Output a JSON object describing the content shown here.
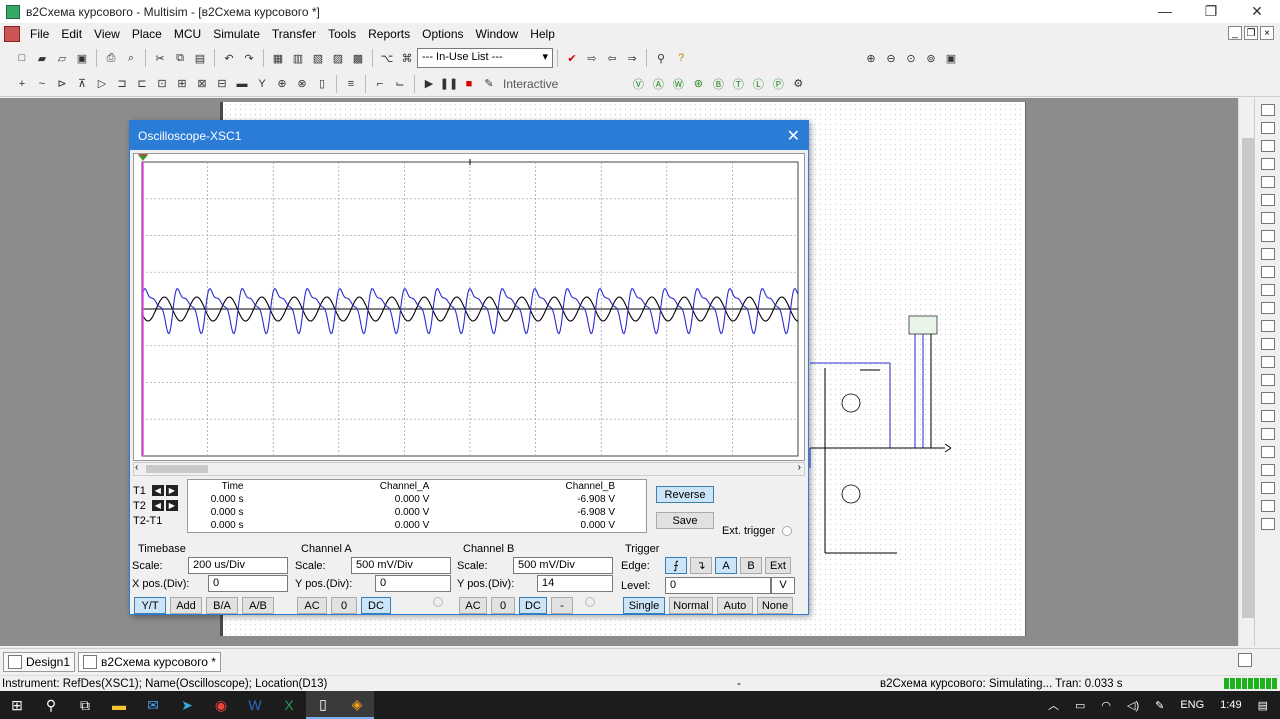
{
  "window": {
    "title": "в2Схема курсового - Multisim - [в2Схема курсового *]",
    "controls": [
      "—",
      "❐",
      "✕"
    ]
  },
  "menu": {
    "items": [
      "File",
      "Edit",
      "View",
      "Place",
      "MCU",
      "Simulate",
      "Transfer",
      "Tools",
      "Reports",
      "Options",
      "Window",
      "Help"
    ]
  },
  "toolbar": {
    "in_use_list": "--- In-Use List ---",
    "interactive_label": "Interactive"
  },
  "oscilloscope": {
    "title": "Oscilloscope-XSC1",
    "close": "✕",
    "readout": {
      "row_labels": [
        "T1",
        "T2",
        "T2-T1"
      ],
      "headers": [
        "Time",
        "Channel_A",
        "Channel_B"
      ],
      "rows": [
        [
          "0.000 s",
          "0.000 V",
          "-6.908 V"
        ],
        [
          "0.000 s",
          "0.000 V",
          "-6.908 V"
        ],
        [
          "0.000 s",
          "0.000 V",
          "0.000 V"
        ]
      ]
    },
    "reverse_label": "Reverse",
    "save_label": "Save",
    "ext_trigger_label": "Ext. trigger",
    "timebase": {
      "title": "Timebase",
      "scale_label": "Scale:",
      "scale": "200 us/Div",
      "xpos_label": "X pos.(Div):",
      "xpos": "0",
      "buttons": [
        "Y/T",
        "Add",
        "B/A",
        "A/B"
      ]
    },
    "channel_a": {
      "title": "Channel A",
      "scale_label": "Scale:",
      "scale": "500 mV/Div",
      "ypos_label": "Y pos.(Div):",
      "ypos": "0",
      "buttons": [
        "AC",
        "0",
        "DC"
      ]
    },
    "channel_b": {
      "title": "Channel B",
      "scale_label": "Scale:",
      "scale": "500 mV/Div",
      "ypos_label": "Y pos.(Div):",
      "ypos": "14",
      "buttons": [
        "AC",
        "0",
        "DC",
        "-"
      ]
    },
    "trigger": {
      "title": "Trigger",
      "edge_label": "Edge:",
      "edge_buttons": [
        "A",
        "B",
        "Ext"
      ],
      "level_label": "Level:",
      "level": "0",
      "level_unit": "V",
      "mode_buttons": [
        "Single",
        "Normal",
        "Auto",
        "None"
      ]
    }
  },
  "tabs": [
    "Design1",
    "в2Схема курсового *"
  ],
  "status": {
    "instrument": "Instrument: RefDes(XSC1); Name(Oscilloscope); Location(D13)",
    "dash": "-",
    "sim": "в2Схема курсового: Simulating... Tran: 0.033 s"
  },
  "taskbar": {
    "lang": "ENG",
    "time": "1:49"
  },
  "colors": {
    "channel_a": "#000000",
    "channel_b": "#2b2bd0",
    "title_bar": "#2a7cd6",
    "cursor": "#ff40ff"
  }
}
